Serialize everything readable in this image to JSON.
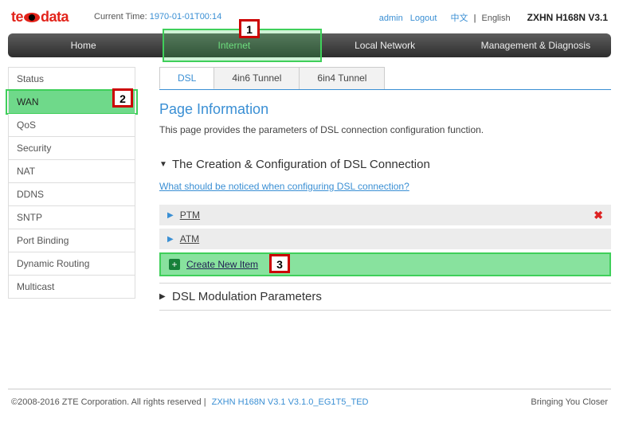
{
  "header": {
    "logo_text": "te  data",
    "current_time_label": "Current Time:",
    "current_time_value": "1970-01-01T00:14",
    "user": "admin",
    "logout": "Logout",
    "lang_cn": "中文",
    "lang_sep": "|",
    "lang_en": "English",
    "model": "ZXHN H168N V3.1"
  },
  "nav": {
    "items": [
      "Home",
      "Internet",
      "Local Network",
      "Management & Diagnosis"
    ],
    "active_index": 1
  },
  "sidebar": {
    "items": [
      "Status",
      "WAN",
      "QoS",
      "Security",
      "NAT",
      "DDNS",
      "SNTP",
      "Port Binding",
      "Dynamic Routing",
      "Multicast"
    ],
    "active_index": 1
  },
  "tabs": {
    "items": [
      "DSL",
      "4in6 Tunnel",
      "6in4 Tunnel"
    ],
    "active_index": 0
  },
  "page": {
    "title": "Page Information",
    "desc": "This page provides the parameters of DSL connection configuration function."
  },
  "section_dsl": {
    "title": "The Creation & Configuration of DSL Connection",
    "help": "What should be noticed when configuring DSL connection?",
    "connections": [
      "PTM",
      "ATM"
    ],
    "create_label": "Create New Item"
  },
  "section_mod": {
    "title": "DSL Modulation Parameters"
  },
  "callouts": {
    "c1": "1",
    "c2": "2",
    "c3": "3"
  },
  "footer": {
    "copyright": "©2008-2016 ZTE Corporation. All rights reserved",
    "sep": " | ",
    "fw": "ZXHN H168N V3.1 V3.1.0_EG1T5_TED",
    "tagline": "Bringing You Closer"
  }
}
